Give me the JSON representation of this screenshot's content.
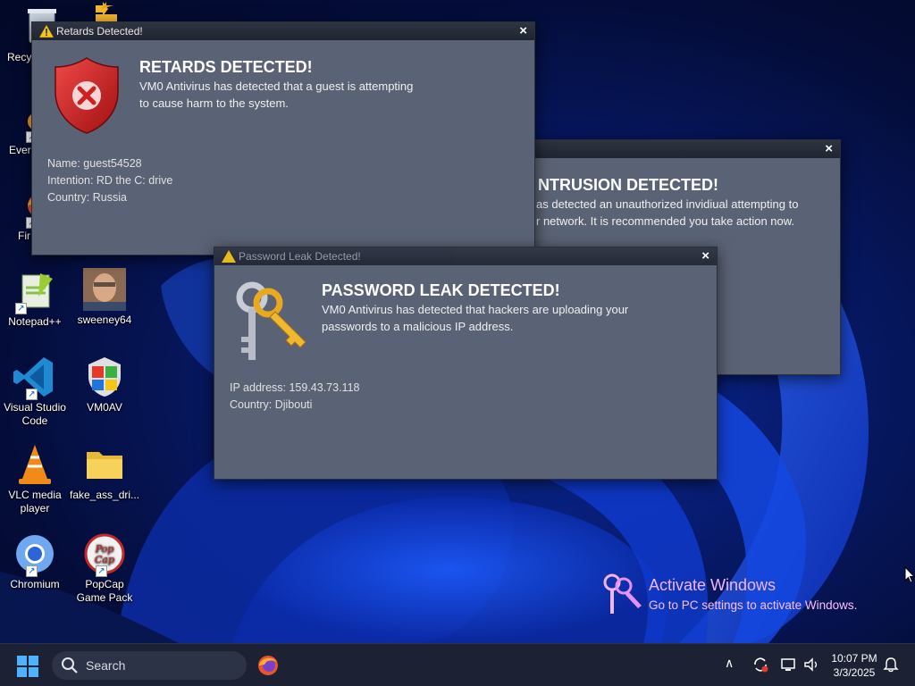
{
  "desktop": {
    "icons": [
      {
        "label": "Recy",
        "icon": "recycle-bin-icon"
      },
      {
        "label": "",
        "icon": "arrows-icon"
      },
      {
        "label": "Ever",
        "icon": "everything-icon"
      },
      {
        "label": "Fir",
        "icon": "firefox-icon"
      },
      {
        "label": "Notepad++",
        "icon": "notepad-plus-plus-icon"
      },
      {
        "label": "sweeney64",
        "icon": "sweeney-photo-icon"
      },
      {
        "label": "Visual Studio Code",
        "icon": "vscode-icon"
      },
      {
        "label": "VM0AV",
        "icon": "vm0av-shield-icon"
      },
      {
        "label": "VLC media player",
        "icon": "vlc-icon"
      },
      {
        "label": "fake_ass_dri...",
        "icon": "folder-icon"
      },
      {
        "label": "Chromium",
        "icon": "chromium-icon"
      },
      {
        "label": "PopCap Game Pack",
        "icon": "popcap-icon"
      }
    ]
  },
  "dialogs": {
    "retards": {
      "title": "Retards Detected!",
      "close": "×",
      "heading": "RETARDS DETECTED!",
      "body_line1": "VM0 Antivirus has detected that a guest is attempting",
      "body_line2": "to cause harm to the system.",
      "name": "Name: guest54528",
      "intention": "Intention: RD the C: drive",
      "country": "Country: Russia"
    },
    "intrusion": {
      "close": "×",
      "heading": "NTRUSION DETECTED!",
      "body_line1": "as detected an unauthorized invidiual attempting to",
      "body_line2": "r network. It is recommended you take action now."
    },
    "password": {
      "title": "Password Leak Detected!",
      "close": "×",
      "heading": "PASSWORD LEAK DETECTED!",
      "body_line1": "VM0 Antivirus has detected that hackers are uploading your",
      "body_line2": "passwords to a malicious IP address.",
      "ip": "IP address: 159.43.73.118",
      "country": "Country: Djibouti"
    }
  },
  "watermark": {
    "title": "Activate Windows",
    "subtitle": "Go to PC settings to activate Windows."
  },
  "taskbar": {
    "search_label": "Search",
    "time": "10:07 PM",
    "date": "3/3/2025"
  },
  "colors": {
    "dialog_bg": "#5a6275",
    "titlebar": "#1f2430",
    "taskbar": "#1c2233",
    "watermark": "#f4b5ff"
  }
}
